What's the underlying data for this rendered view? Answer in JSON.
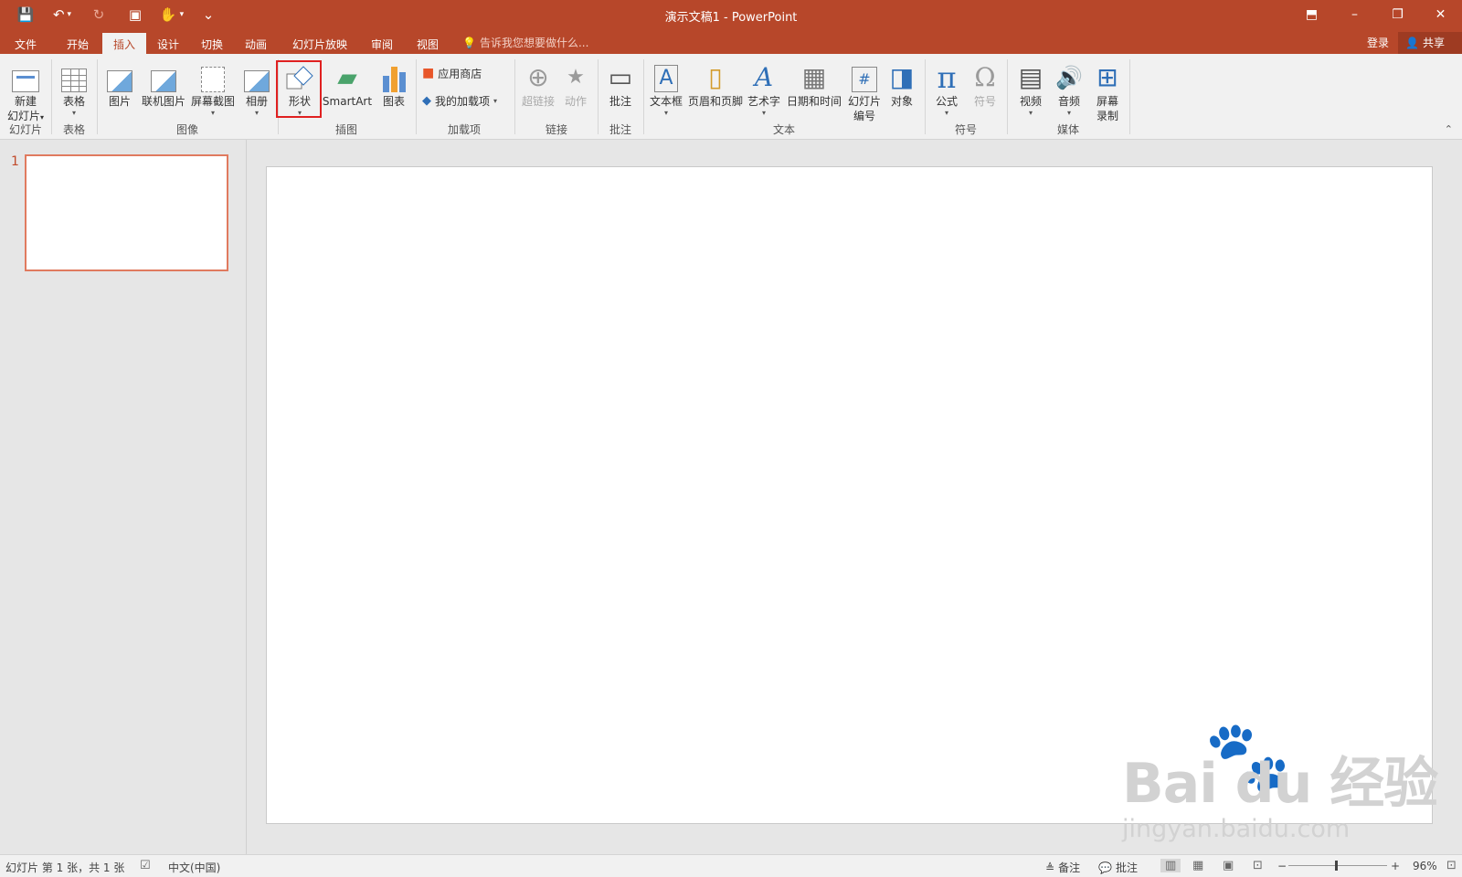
{
  "app": {
    "title": "演示文稿1 - PowerPoint"
  },
  "qat": {
    "save_icon": "💾",
    "undo_icon": "↶",
    "undo_caret": "▾",
    "redo_icon": "↻",
    "present_icon": "▣",
    "touch_icon": "✋",
    "touch_caret": "▾",
    "customize_icon": "⌄"
  },
  "window": {
    "ribbon_display_icon": "⬒",
    "minimize_icon": "–",
    "restore_icon": "❐",
    "close_icon": "✕"
  },
  "tabs": [
    "文件",
    "开始",
    "插入",
    "设计",
    "切换",
    "动画",
    "幻灯片放映",
    "审阅",
    "视图"
  ],
  "active_tab": "插入",
  "tellme": {
    "icon": "💡",
    "text": "告诉我您想要做什么..."
  },
  "account": {
    "signin": "登录",
    "share": "共享",
    "share_icon": "👤"
  },
  "ribbon": {
    "new_slide": {
      "line1": "新建",
      "line2": "幻灯片"
    },
    "table": "表格",
    "picture": "图片",
    "online_picture": "联机图片",
    "screenshot": "屏幕截图",
    "album": "相册",
    "shapes": "形状",
    "smartart": "SmartArt",
    "chart": "图表",
    "store": "应用商店",
    "my_addins": "我的加载项",
    "hyperlink": "超链接",
    "action": "动作",
    "comment": "批注",
    "textbox": "文本框",
    "header_footer": "页眉和页脚",
    "wordart": "艺术字",
    "datetime": "日期和时间",
    "slide_number": {
      "line1": "幻灯片",
      "line2": "编号"
    },
    "object": "对象",
    "equation": "公式",
    "symbol": "符号",
    "video": "视频",
    "audio": "音频",
    "screen_recording": {
      "line1": "屏幕",
      "line2": "录制"
    },
    "caret": "▾",
    "collapse_icon": "⌃",
    "icons": {
      "smartart": "▰",
      "wordart": "A",
      "datetime": "▦",
      "slide_number": "#",
      "object": "◨",
      "equation": "π",
      "symbol": "Ω",
      "video": "▤",
      "audio": "🔊",
      "screen_recording": "⊞",
      "store": "■",
      "my_addins": "◆",
      "hyperlink": "⊕",
      "action": "★",
      "comment": "▭",
      "textbox": "A",
      "header_footer": "▯"
    }
  },
  "groups": {
    "slides": "幻灯片",
    "tables": "表格",
    "images": "图像",
    "illustrations": "插图",
    "addins": "加载项",
    "links": "链接",
    "comments": "批注",
    "text": "文本",
    "symbols": "符号",
    "media": "媒体"
  },
  "thumbnails": [
    {
      "number": "1"
    }
  ],
  "status": {
    "slide_info": "幻灯片 第 1 张，共 1 张",
    "spell_icon": "☑",
    "language": "中文(中国)",
    "notes_icon": "≜",
    "notes": "备注",
    "comments_icon": "💬",
    "comments": "批注",
    "view_normal_icon": "▥",
    "view_sorter_icon": "▦",
    "view_reading_icon": "▣",
    "view_slideshow_icon": "⊡",
    "zoom_out": "−",
    "zoom_in": "+",
    "zoom": "96%",
    "zoom_level": 0.96,
    "fit_icon": "⊡"
  },
  "watermark": {
    "paw": "🐾",
    "main": "Bai du 经验",
    "url": "jingyan.baidu.com"
  }
}
